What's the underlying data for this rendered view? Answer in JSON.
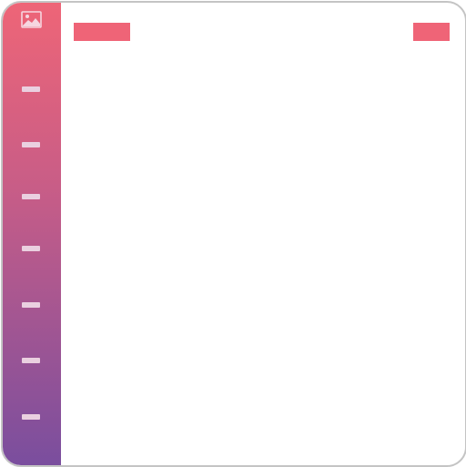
{
  "app": {
    "logo_icon": "image-icon"
  },
  "colors": {
    "accent": "#ef6477",
    "sidebar_top": "#ee6577",
    "sidebar_bottom": "#7a4e9e",
    "nav_item": "#ead0e0",
    "border": "#c4c4c4",
    "background": "#ffffff"
  },
  "sidebar": {
    "items": [
      {
        "icon": "dash-icon",
        "label": ""
      },
      {
        "icon": "dash-icon",
        "label": ""
      },
      {
        "icon": "dash-icon",
        "label": ""
      },
      {
        "icon": "dash-icon",
        "label": ""
      },
      {
        "icon": "dash-icon",
        "label": ""
      },
      {
        "icon": "dash-icon",
        "label": ""
      },
      {
        "icon": "dash-icon",
        "label": ""
      }
    ]
  },
  "header": {
    "tab_label": "",
    "action_label": ""
  },
  "main": {
    "content": ""
  }
}
